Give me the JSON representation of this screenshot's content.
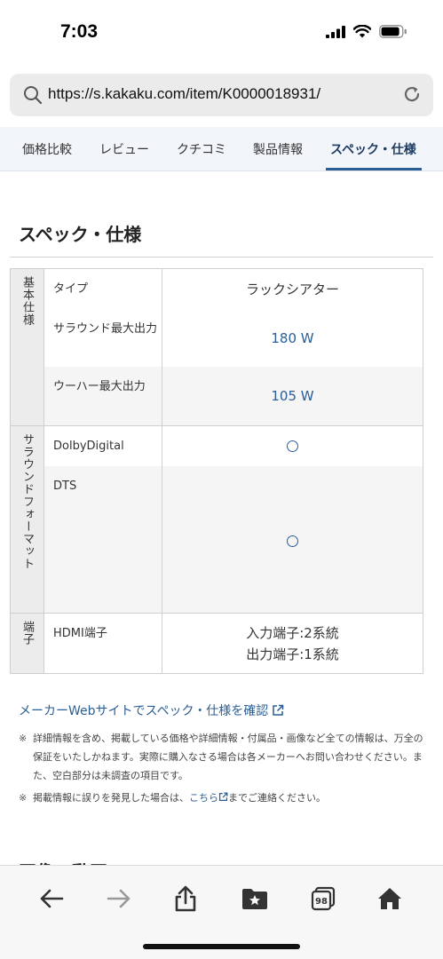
{
  "status_bar": {
    "time": "7:03"
  },
  "browser": {
    "url": "https://s.kakaku.com/item/K0000018931/"
  },
  "tabs": [
    {
      "label": "価格比較",
      "active": false
    },
    {
      "label": "レビュー",
      "active": false
    },
    {
      "label": "クチコミ",
      "active": false
    },
    {
      "label": "製品情報",
      "active": false
    },
    {
      "label": "スペック・仕様",
      "active": true
    }
  ],
  "section_title": "スペック・仕様",
  "spec_groups": [
    {
      "label": "基本仕様",
      "rows": [
        {
          "name": "タイプ",
          "value": "ラックシアター"
        },
        {
          "name": "サラウンド最大出力",
          "value": "180 W"
        },
        {
          "name": "ウーハー最大出力",
          "value": "105 W"
        }
      ]
    },
    {
      "label": "サラウンドフォーマット",
      "rows": [
        {
          "name": "DolbyDigital",
          "value": "○"
        },
        {
          "name": "DTS",
          "value": "○"
        }
      ]
    },
    {
      "label": "端子",
      "rows": [
        {
          "name": "HDMI端子",
          "value_line1": "入力端子:2系統",
          "value_line2": "出力端子:1系統"
        }
      ]
    }
  ],
  "maker_link": "メーカーWebサイトでスペック・仕様を確認",
  "notes": {
    "mark": "※",
    "note1": "詳細情報を含め、掲載している価格や詳細情報・付属品・画像など全ての情報は、万全の保証をいたしかねます。実際に購入なさる場合は各メーカーへお問い合わせください。また、空白部分は未調査の項目です。",
    "note2_before": "掲載情報に誤りを発見した場合は、",
    "note2_link": "こちら",
    "note2_after": "までご連絡ください。"
  },
  "next_heading": "画像・動画",
  "toolbar": {
    "tabs_count": "98"
  },
  "colors": {
    "accent": "#2a5e95",
    "tab_bg": "#f2f6fa",
    "label_bg": "#ececec"
  }
}
